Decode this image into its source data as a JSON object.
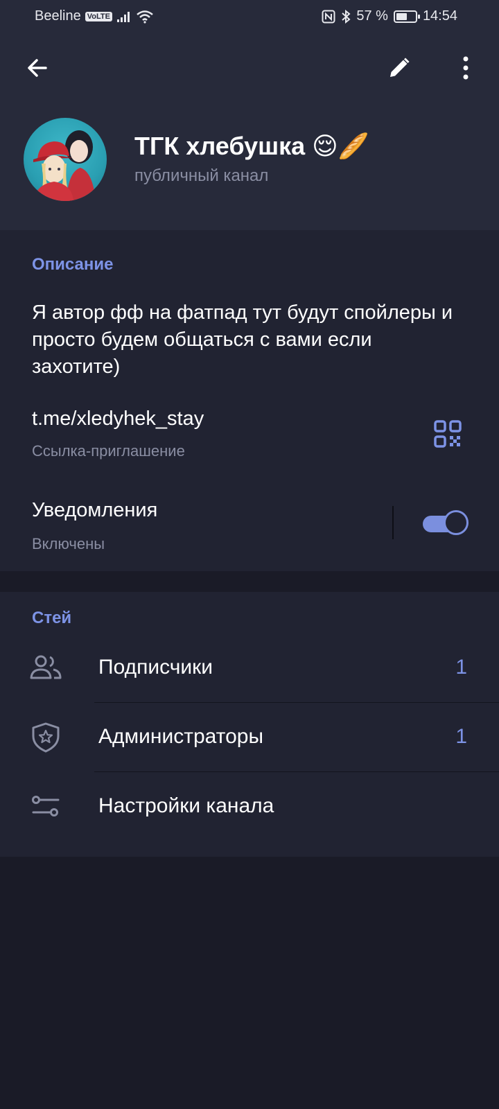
{
  "status_bar": {
    "carrier": "Beeline",
    "volte": "VoLTE",
    "battery": "57 %",
    "battery_level": 0.57,
    "time": "14:54"
  },
  "icons": {
    "back": "arrow-left-icon",
    "edit": "pencil-icon",
    "more": "more-vertical-icon",
    "qr": "qr-code-icon",
    "subscribers": "people-icon",
    "admins": "shield-star-icon",
    "settings": "sliders-icon"
  },
  "channel": {
    "title": "ТГК хлебушка 😌🥖",
    "subtitle": "публичный канал"
  },
  "info": {
    "section_title": "Описание",
    "description": "Я автор фф на фатпад тут будут спойлеры и просто будем общаться с вами если захотите)",
    "link": "t.me/xledyhek_stay",
    "link_label": "Ссылка-приглашение",
    "notifications_label": "Уведомления",
    "notifications_status": "Включены",
    "notifications_on": true
  },
  "manage": {
    "section_title": "Стей",
    "items": [
      {
        "label": "Подписчики",
        "count": "1"
      },
      {
        "label": "Администраторы",
        "count": "1"
      },
      {
        "label": "Настройки канала",
        "count": ""
      }
    ]
  },
  "colors": {
    "accent": "#7d93e6",
    "header_bg": "#272a3a",
    "card_bg": "#212332",
    "page_bg": "#1a1b27",
    "secondary_text": "#8a8ea3"
  }
}
